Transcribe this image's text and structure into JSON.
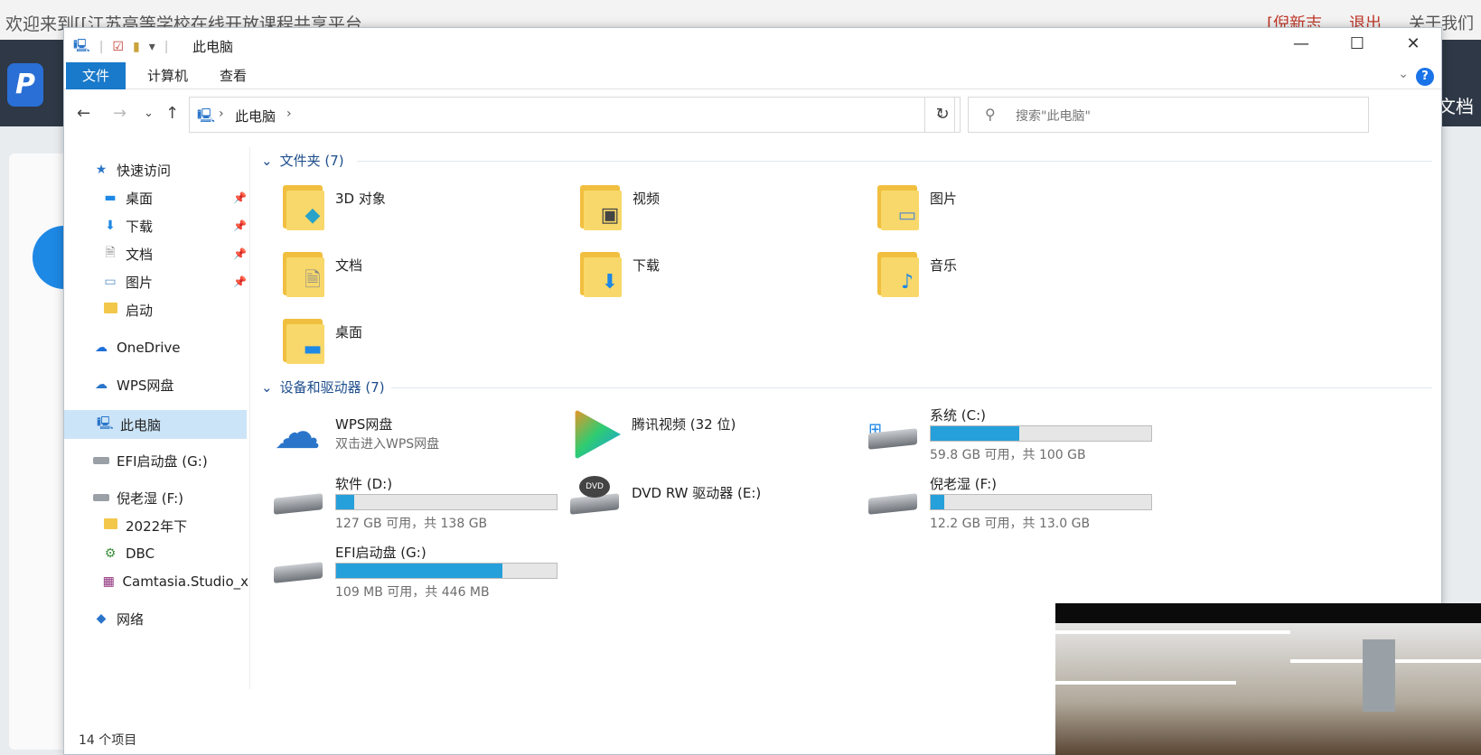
{
  "background_site": {
    "welcome": "欢迎来到[[江苏高等学校在线开放课程共享平台",
    "links": [
      "[倪新志",
      "退出",
      "关于我们"
    ],
    "doc_link": "文档"
  },
  "window": {
    "title": "此电脑",
    "ribbon_tabs": [
      "文件",
      "计算机",
      "查看"
    ],
    "controls": {
      "minimize": "—",
      "maximize": "☐",
      "close": "✕"
    }
  },
  "address": {
    "path": "此电脑",
    "search_placeholder": "搜索\"此电脑\""
  },
  "sidebar": {
    "items": [
      {
        "label": "快速访问"
      },
      {
        "label": "桌面"
      },
      {
        "label": "下载"
      },
      {
        "label": "文档"
      },
      {
        "label": "图片"
      },
      {
        "label": "启动"
      },
      {
        "label": "OneDrive"
      },
      {
        "label": "WPS网盘"
      },
      {
        "label": "此电脑"
      },
      {
        "label": "EFI启动盘 (G:)"
      },
      {
        "label": "倪老湿 (F:)"
      },
      {
        "label": "2022年下"
      },
      {
        "label": "DBC"
      },
      {
        "label": "Camtasia.Studio_x"
      },
      {
        "label": "网络"
      }
    ]
  },
  "groups": {
    "folders_header": "文件夹 (7)",
    "devices_header": "设备和驱动器 (7)"
  },
  "folders": [
    {
      "label": "3D 对象",
      "icon": "3d-objects-icon"
    },
    {
      "label": "视频",
      "icon": "video-icon"
    },
    {
      "label": "图片",
      "icon": "picture-icon"
    },
    {
      "label": "文档",
      "icon": "document-icon"
    },
    {
      "label": "下载",
      "icon": "download-icon"
    },
    {
      "label": "音乐",
      "icon": "music-icon"
    },
    {
      "label": "桌面",
      "icon": "desktop-icon"
    }
  ],
  "devices": [
    {
      "label": "WPS网盘",
      "sub": "双击进入WPS网盘",
      "icon": "cloud-icon"
    },
    {
      "label": "腾讯视频 (32 位)",
      "sub": "",
      "icon": "tencent-video-icon"
    },
    {
      "label": "系统 (C:)",
      "sub": "59.8 GB 可用，共 100 GB",
      "used_fraction": 0.402,
      "icon": "windows-drive-icon"
    },
    {
      "label": "软件 (D:)",
      "sub": "127 GB 可用，共 138 GB",
      "used_fraction": 0.08,
      "icon": "drive-icon"
    },
    {
      "label": "DVD RW 驱动器 (E:)",
      "sub": "",
      "icon": "dvd-icon"
    },
    {
      "label": "倪老湿 (F:)",
      "sub": "12.2 GB 可用，共 13.0 GB",
      "used_fraction": 0.062,
      "icon": "drive-icon"
    },
    {
      "label": "EFI启动盘 (G:)",
      "sub": "109 MB 可用，共 446 MB",
      "used_fraction": 0.756,
      "icon": "drive-icon"
    }
  ],
  "status": "14 个项目",
  "colors": {
    "accent": "#1979ca",
    "bar_fill": "#26a0da",
    "folder": "#f8d86a"
  }
}
